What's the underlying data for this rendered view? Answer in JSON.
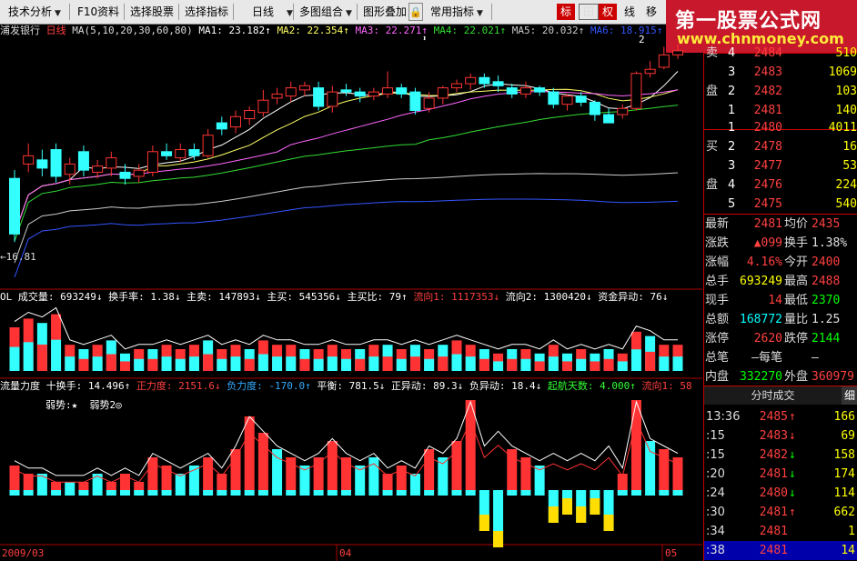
{
  "toolbar": {
    "items": [
      {
        "label": "技术分析",
        "dropdown": true
      },
      {
        "label": "F10资料",
        "dropdown": false
      },
      {
        "label": "选择股票",
        "dropdown": false
      },
      {
        "label": "选择指标",
        "dropdown": false
      },
      {
        "label": "日线",
        "dropdown": true
      },
      {
        "label": "多图组合",
        "dropdown": true
      },
      {
        "label": "图形叠加",
        "dropdown": false
      },
      {
        "label": "常用指标",
        "dropdown": true
      }
    ],
    "modes": [
      "标",
      "田",
      "权",
      "线",
      "移"
    ]
  },
  "watermark": {
    "line1": "第一股票公式网",
    "line2": "www.chnmoney.com"
  },
  "main_header": {
    "stock_name": "浦发银行",
    "period": "日线",
    "ma_def": "MA(5,10,20,30,60,80)",
    "ma1": "MA1: 23.182↑",
    "ma2": "MA2: 22.354↑",
    "ma3": "MA3: 22.271↑",
    "ma4": "MA4: 22.021↑",
    "ma5": "MA5: 20.032↑",
    "ma6": "MA6: 18.915↑",
    "low_label": "←16.81",
    "high_mark": "2"
  },
  "vol_header": {
    "name": "OL 成交量: 693249↓",
    "turnover": "换手率: 1.38↓",
    "sell": "主卖: 147893↓",
    "buy": "主买: 545356↓",
    "ratio": "主买比: 79↑",
    "flow1": "流向1: 1117353↓",
    "flow2": "流向2: 1300420↓",
    "abnormal": "资金异动: 76↓"
  },
  "ind_header": {
    "name": "流量力度",
    "turnover": "十换手: 14.496↑",
    "pos": "正力度: 2151.6↓",
    "neg": "负力度: -170.0↑",
    "balance": "平衡: 781.5↓",
    "pos_ab": "正异动: 89.3↓",
    "neg_ab": "负异动: 18.4↓",
    "launch": "起航天数: 4.000↑",
    "flow": "流向1: 58",
    "weak1": "弱势:★",
    "weak2": "弱势2◎"
  },
  "date_labels": [
    "2009/03",
    "04",
    "05"
  ],
  "order_book": {
    "sell": [
      {
        "label": "卖",
        "level": "4",
        "price": "2484",
        "volume": "510"
      },
      {
        "label": "",
        "level": "3",
        "price": "2483",
        "volume": "1069"
      },
      {
        "label": "盘",
        "level": "2",
        "price": "2482",
        "volume": "103"
      },
      {
        "label": "",
        "level": "1",
        "price": "2481",
        "volume": "140"
      }
    ],
    "buy": [
      {
        "label": "",
        "level": "1",
        "price": "2480",
        "volume": "4011"
      },
      {
        "label": "买",
        "level": "2",
        "price": "2478",
        "volume": "16"
      },
      {
        "label": "",
        "level": "3",
        "price": "2477",
        "volume": "53"
      },
      {
        "label": "盘",
        "level": "4",
        "price": "2476",
        "volume": "224"
      },
      {
        "label": "",
        "level": "5",
        "price": "2475",
        "volume": "540"
      }
    ]
  },
  "quote": [
    {
      "l1": "最新",
      "v1": "2481",
      "c1": "red",
      "l2": "均价",
      "v2": "2435",
      "c2": "red"
    },
    {
      "l1": "涨跌",
      "v1": "▲099",
      "c1": "red",
      "l2": "换手",
      "v2": "1.38%",
      "c2": "wht"
    },
    {
      "l1": "涨幅",
      "v1": "4.16%",
      "c1": "red",
      "l2": "今开",
      "v2": "2400",
      "c2": "red"
    },
    {
      "l1": "总手",
      "v1": "693249",
      "c1": "yel",
      "l2": "最高",
      "v2": "2488",
      "c2": "red"
    },
    {
      "l1": "现手",
      "v1": "14",
      "c1": "red",
      "l2": "最低",
      "v2": "2370",
      "c2": "green"
    },
    {
      "l1": "总额",
      "v1": "168772",
      "c1": "cyan",
      "l2": "量比",
      "v2": "1.25",
      "c2": "wht"
    },
    {
      "l1": "涨停",
      "v1": "2620",
      "c1": "red",
      "l2": "跌停",
      "v2": "2144",
      "c2": "green"
    },
    {
      "l1": "总笔",
      "v1": "—每笔",
      "c1": "wht",
      "l2": "",
      "v2": "—",
      "c2": "wht"
    },
    {
      "l1": "内盘",
      "v1": "332270",
      "c1": "green",
      "l2": "外盘",
      "v2": "360979",
      "c2": "red"
    }
  ],
  "ticks": {
    "title": "分时成交",
    "detail_button": "细",
    "rows": [
      {
        "time": "13:36",
        "price": "2485",
        "dir": "↑",
        "vol": "166",
        "c": "red"
      },
      {
        "time": ":15",
        "price": "2483",
        "dir": "↓",
        "vol": "69",
        "c": "red"
      },
      {
        "time": ":15",
        "price": "2482",
        "dir": "↓",
        "vol": "158",
        "c": "green"
      },
      {
        "time": ":20",
        "price": "2481",
        "dir": "↓",
        "vol": "174",
        "c": "green"
      },
      {
        "time": ":24",
        "price": "2480",
        "dir": "↓",
        "vol": "114",
        "c": "green"
      },
      {
        "time": ":30",
        "price": "2481",
        "dir": "↑",
        "vol": "662",
        "c": "red"
      },
      {
        "time": ":34",
        "price": "2481",
        "dir": "",
        "vol": "1",
        "c": "red"
      },
      {
        "time": ":38",
        "price": "2481",
        "dir": "",
        "vol": "14",
        "c": "red"
      }
    ]
  },
  "colors": {
    "up": "#ff3333",
    "down": "#33ffff",
    "ma1": "#ffffff",
    "ma2": "#ffff66",
    "ma3": "#ff66ff",
    "ma4": "#33dd33",
    "ma5": "#cccccc",
    "ma6": "#3355ff"
  },
  "chart_data": {
    "type": "candlestick",
    "candles": [
      [
        19.9,
        17.2,
        20.3,
        16.81
      ],
      [
        20.6,
        21.0,
        21.6,
        20.2
      ],
      [
        20.8,
        20.4,
        21.3,
        20.0
      ],
      [
        21.3,
        20.0,
        21.6,
        19.7
      ],
      [
        20.1,
        20.6,
        20.9,
        19.6
      ],
      [
        21.2,
        20.3,
        21.5,
        20.0
      ],
      [
        20.2,
        20.5,
        20.8,
        19.9
      ],
      [
        20.4,
        20.9,
        21.2,
        20.0
      ],
      [
        20.2,
        19.9,
        20.6,
        19.6
      ],
      [
        20.0,
        20.3,
        20.6,
        19.7
      ],
      [
        20.2,
        21.2,
        21.5,
        20.0
      ],
      [
        21.2,
        21.0,
        21.6,
        20.8
      ],
      [
        20.9,
        21.3,
        21.6,
        20.7
      ],
      [
        21.3,
        21.0,
        21.6,
        20.8
      ],
      [
        21.0,
        22.0,
        22.3,
        20.9
      ],
      [
        22.6,
        22.3,
        22.9,
        22.0
      ],
      [
        22.4,
        22.9,
        23.2,
        22.1
      ],
      [
        22.8,
        23.2,
        23.4,
        22.5
      ],
      [
        23.1,
        23.7,
        24.2,
        22.9
      ],
      [
        23.8,
        24.0,
        24.3,
        23.5
      ],
      [
        23.9,
        24.3,
        24.6,
        23.6
      ],
      [
        24.2,
        24.4,
        24.6,
        23.9
      ],
      [
        24.3,
        23.4,
        24.6,
        23.2
      ],
      [
        23.4,
        24.1,
        24.4,
        23.1
      ],
      [
        24.2,
        24.1,
        24.5,
        23.9
      ],
      [
        24.1,
        23.9,
        24.3,
        23.6
      ],
      [
        23.9,
        24.1,
        24.3,
        23.7
      ],
      [
        24.0,
        24.3,
        25.1,
        23.8
      ],
      [
        24.3,
        24.0,
        24.5,
        23.8
      ],
      [
        24.1,
        23.2,
        24.3,
        23.0
      ],
      [
        23.3,
        23.8,
        24.1,
        23.1
      ],
      [
        23.8,
        24.3,
        24.4,
        23.5
      ],
      [
        24.3,
        24.5,
        24.7,
        24.1
      ],
      [
        24.5,
        24.8,
        25.0,
        24.2
      ],
      [
        24.8,
        24.5,
        25.0,
        24.3
      ],
      [
        24.6,
        24.4,
        24.9,
        24.1
      ],
      [
        24.3,
        24.0,
        24.5,
        23.8
      ],
      [
        24.0,
        24.3,
        24.6,
        23.8
      ],
      [
        24.3,
        24.1,
        24.4,
        23.9
      ],
      [
        24.1,
        23.5,
        24.3,
        23.3
      ],
      [
        23.5,
        23.9,
        24.0,
        23.2
      ],
      [
        23.9,
        23.6,
        24.1,
        23.4
      ],
      [
        23.6,
        23.0,
        23.7,
        22.7
      ],
      [
        23.0,
        22.6,
        23.3,
        22.6
      ],
      [
        23.0,
        23.3,
        23.5,
        22.8
      ],
      [
        23.3,
        25.0,
        25.1,
        23.2
      ],
      [
        25.0,
        25.2,
        25.6,
        24.8
      ],
      [
        25.3,
        25.9,
        26.3,
        25.2
      ],
      [
        25.9,
        26.1,
        26.4,
        25.7
      ]
    ],
    "volume": [
      [
        1.0,
        1
      ],
      [
        1.2,
        1
      ],
      [
        1.1,
        -1
      ],
      [
        1.3,
        1
      ],
      [
        0.6,
        1
      ],
      [
        0.5,
        -1
      ],
      [
        0.6,
        1
      ],
      [
        0.7,
        -1
      ],
      [
        0.4,
        -1
      ],
      [
        0.5,
        1
      ],
      [
        0.5,
        -1
      ],
      [
        0.6,
        1
      ],
      [
        0.5,
        1
      ],
      [
        0.6,
        1
      ],
      [
        0.7,
        -1
      ],
      [
        0.5,
        1
      ],
      [
        0.6,
        1
      ],
      [
        0.5,
        -1
      ],
      [
        0.7,
        1
      ],
      [
        0.6,
        1
      ],
      [
        0.6,
        1
      ],
      [
        0.5,
        -1
      ],
      [
        0.5,
        1
      ],
      [
        0.6,
        1
      ],
      [
        0.5,
        1
      ],
      [
        0.5,
        -1
      ],
      [
        0.6,
        1
      ],
      [
        0.6,
        -1
      ],
      [
        0.5,
        1
      ],
      [
        0.6,
        -1
      ],
      [
        0.5,
        1
      ],
      [
        0.6,
        -1
      ],
      [
        0.7,
        1
      ],
      [
        0.6,
        1
      ],
      [
        0.5,
        -1
      ],
      [
        0.4,
        1
      ],
      [
        0.5,
        -1
      ],
      [
        0.5,
        1
      ],
      [
        0.4,
        -1
      ],
      [
        0.6,
        1
      ],
      [
        0.4,
        -1
      ],
      [
        0.5,
        1
      ],
      [
        0.4,
        -1
      ],
      [
        0.5,
        -1
      ],
      [
        0.4,
        1
      ],
      [
        0.9,
        1
      ],
      [
        0.8,
        -1
      ],
      [
        0.6,
        1
      ],
      [
        0.6,
        1
      ]
    ],
    "flow": [
      [
        3,
        1
      ],
      [
        2,
        1
      ],
      [
        2,
        -1
      ],
      [
        1,
        1
      ],
      [
        1,
        -1
      ],
      [
        1,
        1
      ],
      [
        2,
        -1
      ],
      [
        1,
        1
      ],
      [
        2,
        1
      ],
      [
        1,
        1
      ],
      [
        4,
        1
      ],
      [
        3,
        1
      ],
      [
        2,
        -1
      ],
      [
        3,
        -1
      ],
      [
        4,
        1
      ],
      [
        2,
        1
      ],
      [
        5,
        1
      ],
      [
        9,
        1
      ],
      [
        7,
        1
      ],
      [
        5,
        -1
      ],
      [
        4,
        1
      ],
      [
        3,
        -1
      ],
      [
        4,
        1
      ],
      [
        6,
        1
      ],
      [
        4,
        1
      ],
      [
        3,
        -1
      ],
      [
        4,
        -1
      ],
      [
        2,
        1
      ],
      [
        3,
        1
      ],
      [
        2,
        -1
      ],
      [
        5,
        1
      ],
      [
        4,
        -1
      ],
      [
        6,
        1
      ],
      [
        11,
        1
      ],
      [
        -5,
        -1
      ],
      [
        -7,
        -1
      ],
      [
        5,
        1
      ],
      [
        4,
        1
      ],
      [
        3,
        -1
      ],
      [
        -4,
        -1
      ],
      [
        -3,
        -1
      ],
      [
        -4,
        -1
      ],
      [
        -3,
        -1
      ],
      [
        -5,
        -1
      ],
      [
        2,
        1
      ],
      [
        11,
        1
      ],
      [
        6,
        -1
      ],
      [
        5,
        1
      ],
      [
        4,
        1
      ]
    ]
  }
}
